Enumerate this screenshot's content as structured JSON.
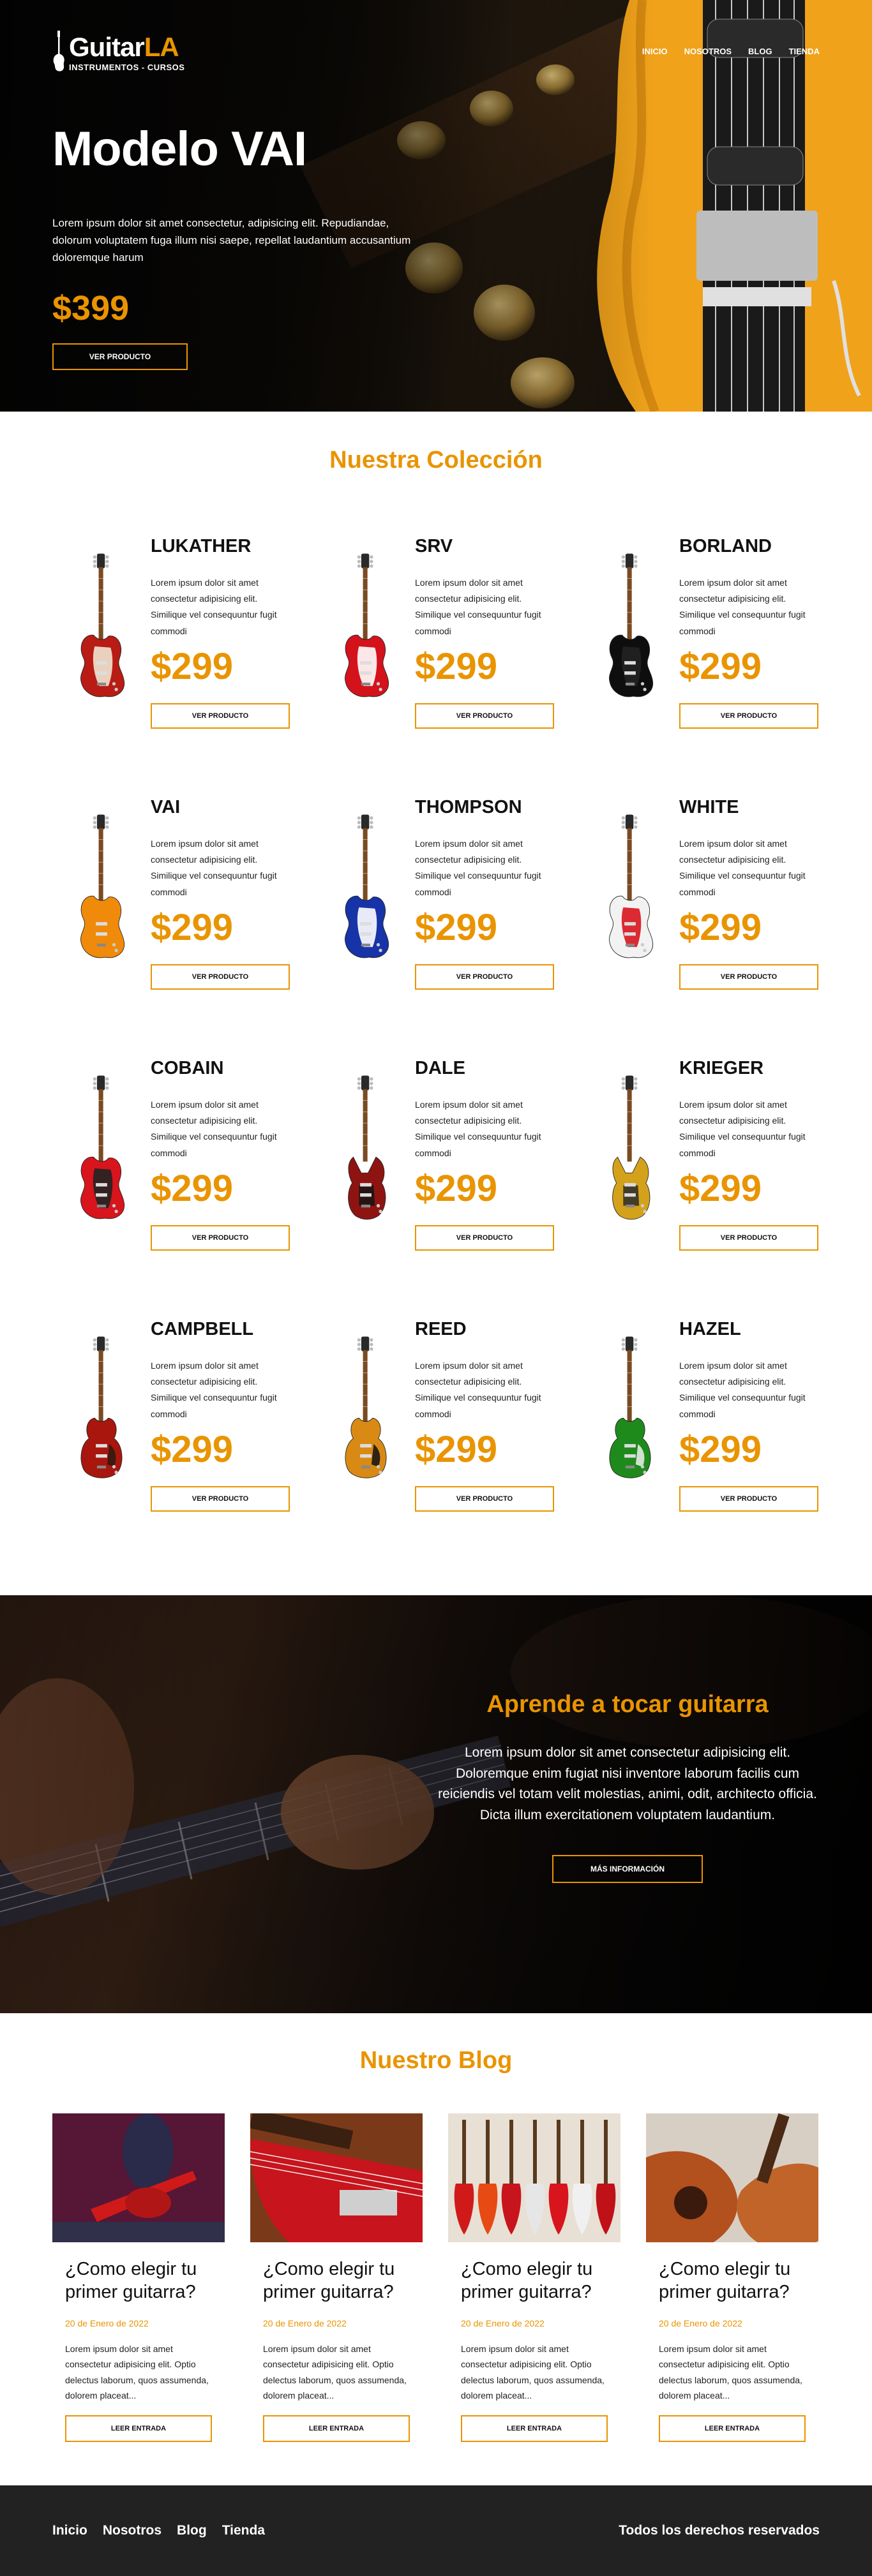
{
  "header": {
    "logo_name": "Guitar",
    "logo_accent": "LA",
    "logo_sub": "INSTRUMENTOS - CURSOS",
    "nav": [
      "Inicio",
      "Nosotros",
      "Blog",
      "Tienda"
    ]
  },
  "hero": {
    "title": "Modelo VAI",
    "description": "Lorem ipsum dolor sit amet consectetur, adipisicing elit. Repudiandae, dolorum voluptatem fuga illum nisi saepe, repellat laudantium accusantium doloremque harum",
    "price": "$399",
    "button": "VER PRODUCTO"
  },
  "collection": {
    "title": "Nuestra Colección",
    "button": "VER PRODUCTO",
    "items": [
      {
        "name": "LUKATHER",
        "desc": "Lorem ipsum dolor sit amet consectetur adipisicing elit. Similique vel consequuntur fugit commodi",
        "price": "$299",
        "body": "#b81c14",
        "pick": "#f0e6d0",
        "style": "strat"
      },
      {
        "name": "SRV",
        "desc": "Lorem ipsum dolor sit amet consectetur adipisicing elit. Similique vel consequuntur fugit commodi",
        "price": "$299",
        "body": "#d4121c",
        "pick": "#ffffff",
        "style": "strat"
      },
      {
        "name": "BORLAND",
        "desc": "Lorem ipsum dolor sit amet consectetur adipisicing elit. Similique vel consequuntur fugit commodi",
        "price": "$299",
        "body": "#0e0e0e",
        "pick": "#222222",
        "style": "strat"
      },
      {
        "name": "VAI",
        "desc": "Lorem ipsum dolor sit amet consectetur adipisicing elit. Similique vel consequuntur fugit commodi",
        "price": "$299",
        "body": "#f08a0a",
        "pick": "#f08a0a",
        "style": "strat"
      },
      {
        "name": "THOMPSON",
        "desc": "Lorem ipsum dolor sit amet consectetur adipisicing elit. Similique vel consequuntur fugit commodi",
        "price": "$299",
        "body": "#1733a8",
        "pick": "#ffffff",
        "style": "strat"
      },
      {
        "name": "WHITE",
        "desc": "Lorem ipsum dolor sit amet consectetur adipisicing elit. Similique vel consequuntur fugit commodi",
        "price": "$299",
        "body": "#f2f2f2",
        "pick": "#d8141c",
        "style": "strat"
      },
      {
        "name": "COBAIN",
        "desc": "Lorem ipsum dolor sit amet consectetur adipisicing elit. Similique vel consequuntur fugit commodi",
        "price": "$299",
        "body": "#d8141c",
        "pick": "#222222",
        "style": "strat"
      },
      {
        "name": "DALE",
        "desc": "Lorem ipsum dolor sit amet consectetur adipisicing elit. Similique vel consequuntur fugit commodi",
        "price": "$299",
        "body": "#8e1412",
        "pick": "#141414",
        "style": "sg"
      },
      {
        "name": "KRIEGER",
        "desc": "Lorem ipsum dolor sit amet consectetur adipisicing elit. Similique vel consequuntur fugit commodi",
        "price": "$299",
        "body": "#d4a21a",
        "pick": "#2a2a2a",
        "style": "sg"
      },
      {
        "name": "CAMPBELL",
        "desc": "Lorem ipsum dolor sit amet consectetur adipisicing elit. Similique vel consequuntur fugit commodi",
        "price": "$299",
        "body": "#a8160e",
        "pick": "#2a1a10",
        "style": "lp"
      },
      {
        "name": "REED",
        "desc": "Lorem ipsum dolor sit amet consectetur adipisicing elit. Similique vel consequuntur fugit commodi",
        "price": "$299",
        "body": "#d98a14",
        "pick": "#111111",
        "style": "lp"
      },
      {
        "name": "HAZEL",
        "desc": "Lorem ipsum dolor sit amet consectetur adipisicing elit. Similique vel consequuntur fugit commodi",
        "price": "$299",
        "body": "#1f8a1c",
        "pick": "#f0f0f0",
        "style": "lp"
      }
    ]
  },
  "lessons": {
    "title": "Aprende a tocar guitarra",
    "text": "Lorem ipsum dolor sit amet consectetur adipisicing elit. Doloremque enim fugiat nisi inventore laborum facilis cum reiciendis vel totam velit molestias, animi, odit, architecto officia. Dicta illum exercitationem voluptatem laudantium.",
    "button": "MÁS INFORMACIÓN"
  },
  "blog": {
    "title": "Nuestro Blog",
    "button": "LEER ENTRADA",
    "posts": [
      {
        "title": "¿Como elegir tu primer guitarra?",
        "date": "20 de Enero de 2022",
        "desc": "Lorem ipsum dolor sit amet consectetur adipisicing elit. Optio delectus laborum, quos assumenda, dolorem placeat...",
        "img": "player"
      },
      {
        "title": "¿Como elegir tu primer guitarra?",
        "date": "20 de Enero de 2022",
        "desc": "Lorem ipsum dolor sit amet consectetur adipisicing elit. Optio delectus laborum, quos assumenda, dolorem placeat...",
        "img": "redguitar"
      },
      {
        "title": "¿Como elegir tu primer guitarra?",
        "date": "20 de Enero de 2022",
        "desc": "Lorem ipsum dolor sit amet consectetur adipisicing elit. Optio delectus laborum, quos assumenda, dolorem placeat...",
        "img": "wall"
      },
      {
        "title": "¿Como elegir tu primer guitarra?",
        "date": "20 de Enero de 2022",
        "desc": "Lorem ipsum dolor sit amet consectetur adipisicing elit. Optio delectus laborum, quos assumenda, dolorem placeat...",
        "img": "acoustic"
      }
    ]
  },
  "footer": {
    "links": [
      "Inicio",
      "Nosotros",
      "Blog",
      "Tienda"
    ],
    "copy": "Todos los derechos reservados"
  },
  "colors": {
    "accent": "#e99401",
    "footer": "#222222"
  }
}
